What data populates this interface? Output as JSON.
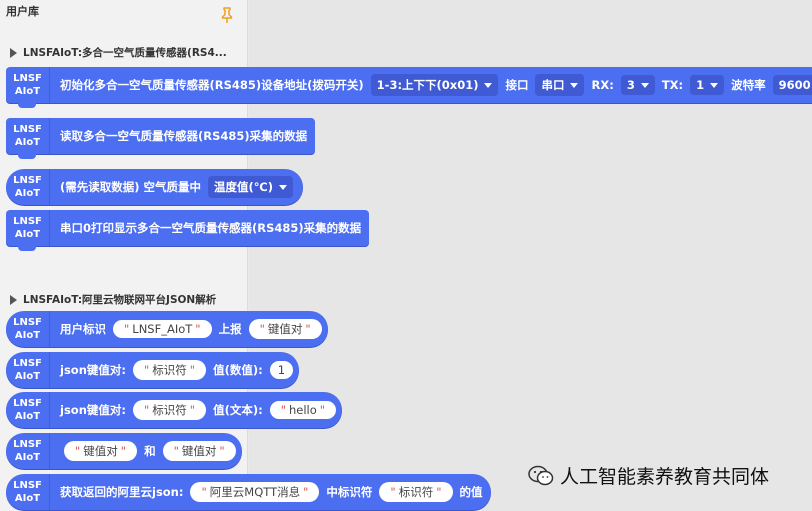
{
  "sidebar": {
    "title": "用户库",
    "pin_icon": "pin-icon"
  },
  "logo": {
    "line1": "LNSF",
    "line2": "AIoT"
  },
  "categories": [
    {
      "label": "LNSFAIoT:多合一空气质量传感器(RS4..."
    },
    {
      "label": "LNSFAIoT:阿里云物联网平台JSON解析"
    }
  ],
  "blocks": {
    "init": {
      "label": "初始化多合一空气质量传感器(RS485)设备地址(拨码开关)",
      "addr": "1-3:上下下(0x01)",
      "port_label": "接口",
      "port": "串口",
      "rx_label": "RX:",
      "rx": "3",
      "tx_label": "TX:",
      "tx": "1",
      "baud_label": "波特率",
      "baud": "9600"
    },
    "read": {
      "label": "读取多合一空气质量传感器(RS485)采集的数据"
    },
    "air": {
      "label": "(需先读取数据) 空气质量中",
      "field": "温度值(℃)"
    },
    "print": {
      "label": "串口0打印显示多合一空气质量传感器(RS485)采集的数据"
    },
    "report": {
      "label1": "用户标识",
      "user_id": "LNSF_AIoT",
      "label2": "上报",
      "payload": "键值对"
    },
    "kv_num": {
      "label": "json键值对:",
      "key": "标识符",
      "val_label": "值(数值):",
      "value": "1"
    },
    "kv_text": {
      "label": "json键值对:",
      "key": "标识符",
      "val_label": "值(文本):",
      "value": "hello"
    },
    "join": {
      "left": "键值对",
      "and": "和",
      "right": "键值对"
    },
    "get": {
      "label1": "获取返回的阿里云json:",
      "msg": "阿里云MQTT消息",
      "label2": "中标识符",
      "key": "标识符",
      "label3": "的值"
    }
  },
  "quote_left": "\"",
  "quote_right": "\"",
  "watermark": {
    "text": "人工智能素养教育共同体",
    "icon": "wechat-icon"
  }
}
